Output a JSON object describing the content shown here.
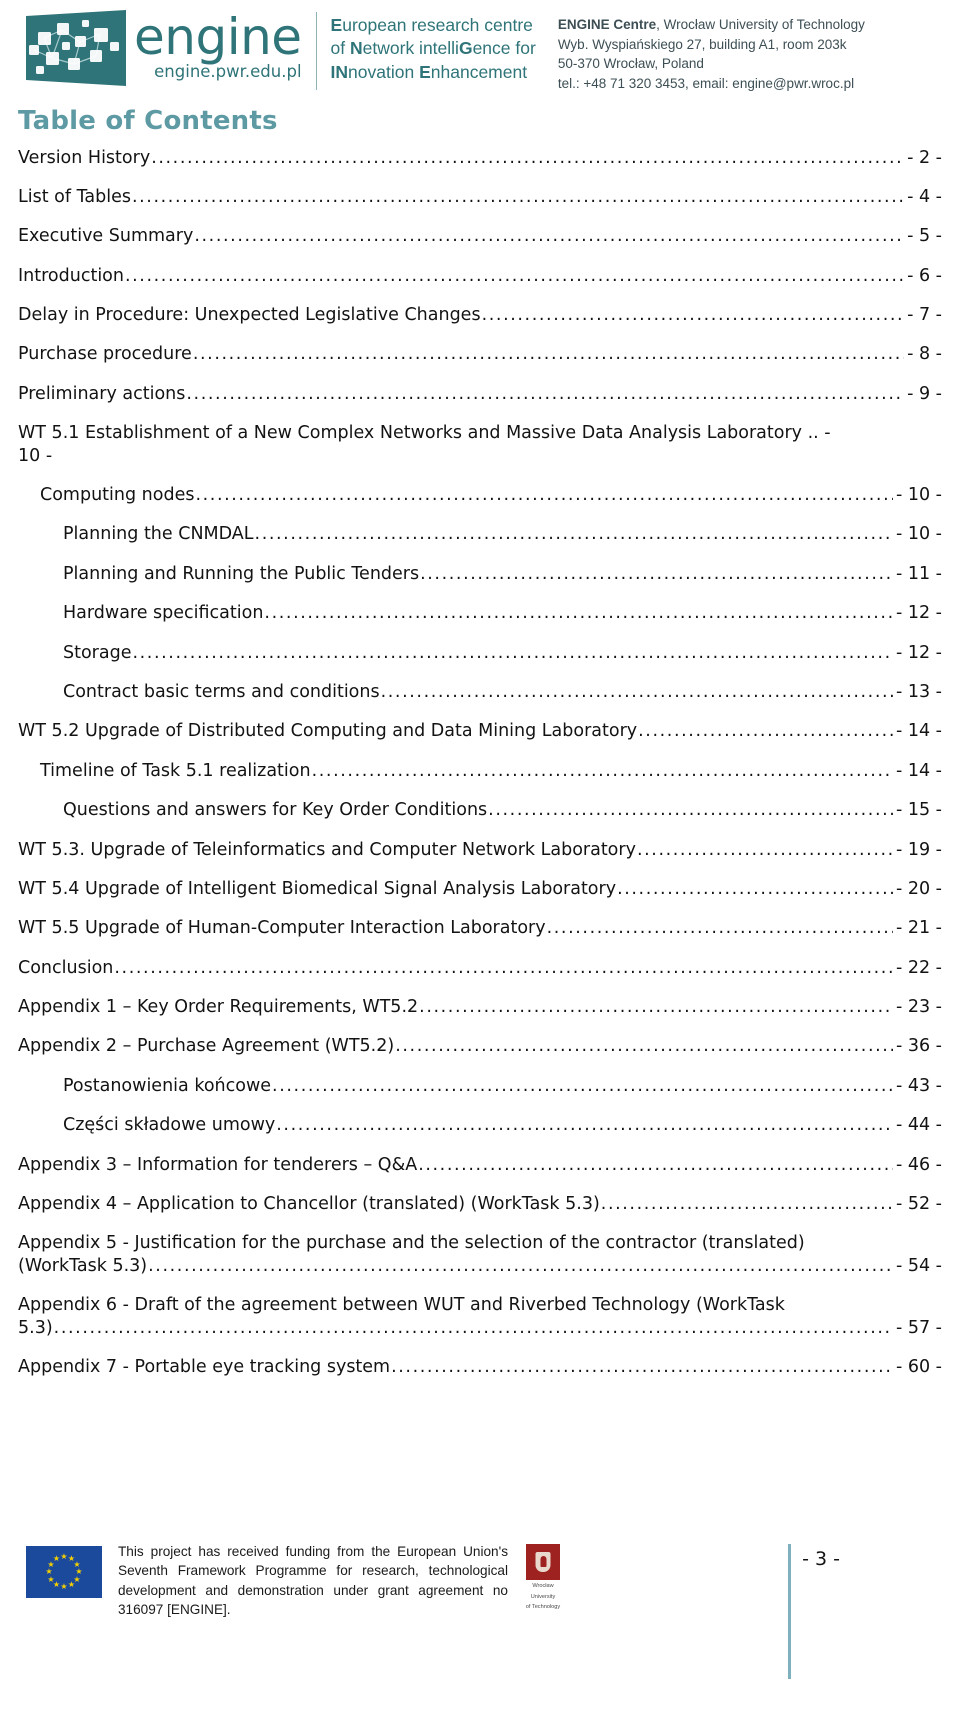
{
  "header": {
    "logo": {
      "wordmark": "engine",
      "url": "engine.pwr.edu.pl"
    },
    "tagline": {
      "line1_a": "E",
      "line1_b": "uropean research centre",
      "line2_a": "N",
      "line2_b": "etwork intelli",
      "line2_c": "G",
      "line2_d": "ence for",
      "line2_pre": "of ",
      "line3_a": "IN",
      "line3_b": "novation ",
      "line3_c": "E",
      "line3_d": "nhancement",
      "full_line1": "European research centre",
      "full_line2": "of Network intelliGence for",
      "full_line3": "INnovation Enhancement"
    },
    "contact": {
      "org_bold": "ENGINE Centre",
      "org_rest": ", Wrocław University of Technology",
      "address1": "Wyb. Wyspiańskiego 27, building A1, room 203k",
      "address2": "50-370 Wrocław, Poland",
      "contact_line": "tel.: +48 71 320 3453, email: engine@pwr.wroc.pl"
    }
  },
  "toc": {
    "title": "Table of Contents",
    "entries": [
      {
        "label": "Version History",
        "page": "- 2 -",
        "level": 0
      },
      {
        "label": "List of Tables",
        "page": "- 4 -",
        "level": 0
      },
      {
        "label": "Executive Summary",
        "page": "- 5 -",
        "level": 0
      },
      {
        "label": "Introduction",
        "page": "- 6 -",
        "level": 0
      },
      {
        "label": "Delay in Procedure: Unexpected  Legislative Changes",
        "page": "- 7 -",
        "level": 0
      },
      {
        "label": "Purchase procedure",
        "page": "- 8 -",
        "level": 0
      },
      {
        "label": "Preliminary actions",
        "page": "- 9 -",
        "level": 0
      },
      {
        "label": "WT 5.1 Establishment of a New Complex Networks and Massive Data Analysis Laboratory",
        "page": "- 10 -",
        "level": 0,
        "wrap": true,
        "wrap_tail": "10 -",
        "wrap_head_dots": ".. -"
      },
      {
        "label": "Computing nodes",
        "page": "- 10 -",
        "level": 1
      },
      {
        "label": "Planning the CNMDAL",
        "page": "- 10 -",
        "level": 2
      },
      {
        "label": "Planning and Running the Public Tenders",
        "page": "- 11 -",
        "level": 2
      },
      {
        "label": "Hardware specification",
        "page": "- 12 -",
        "level": 2
      },
      {
        "label": "Storage",
        "page": "- 12 -",
        "level": 2
      },
      {
        "label": "Contract basic terms and conditions",
        "page": "- 13 -",
        "level": 2
      },
      {
        "label": "WT 5.2 Upgrade of Distributed Computing and Data Mining Laboratory",
        "page": "- 14 -",
        "level": 0
      },
      {
        "label": "Timeline of Task 5.1 realization",
        "page": "- 14 -",
        "level": 1
      },
      {
        "label": "Questions and answers for Key Order Conditions",
        "page": "- 15 -",
        "level": 2
      },
      {
        "label": "WT 5.3. Upgrade of Teleinformatics and Computer Network Laboratory",
        "page": "- 19 -",
        "level": 0
      },
      {
        "label": "WT 5.4 Upgrade of Intelligent Biomedical Signal Analysis Laboratory",
        "page": "- 20 -",
        "level": 0
      },
      {
        "label": "WT 5.5 Upgrade of Human-Computer Interaction Laboratory",
        "page": "- 21 -",
        "level": 0
      },
      {
        "label": "Conclusion",
        "page": "- 22 -",
        "level": 0
      },
      {
        "label": "Appendix 1 – Key Order Requirements, WT5.2",
        "page": "- 23 -",
        "level": 0
      },
      {
        "label": "Appendix 2 – Purchase Agreement (WT5.2)",
        "page": "- 36 -",
        "level": 0
      },
      {
        "label": "Postanowienia końcowe",
        "page": "- 43 -",
        "level": 2
      },
      {
        "label": "Części składowe umowy",
        "page": "- 44 -",
        "level": 2
      },
      {
        "label": "Appendix 3 – Information for tenderers – Q&A",
        "page": "- 46 -",
        "level": 0
      },
      {
        "label": "Appendix 4 – Application to  Chancellor (translated) (WorkTask 5.3)",
        "page": "- 52 -",
        "level": 0
      },
      {
        "label": "Appendix 5 - Justification for the purchase and the selection of the contractor (translated)",
        "page": "- 54 -",
        "level": 0,
        "wrap": true,
        "wrap_tail": "(WorkTask 5.3)"
      },
      {
        "label": "Appendix 6 - Draft of the agreement between WUT and Riverbed Technology (WorkTask",
        "page": "- 57 -",
        "level": 0,
        "wrap": true,
        "wrap_tail": "5.3)"
      },
      {
        "label": "Appendix 7 - Portable eye tracking system",
        "page": "- 60 -",
        "level": 0
      }
    ]
  },
  "footer": {
    "funding_text": "This project has received funding from the European Union's Seventh Framework Programme for research, technological development and demonstration under grant agreement no 316097 [ENGINE].",
    "university_caption_1": "Wrocław",
    "university_caption_2": "University",
    "university_caption_3": "of Technology",
    "page_number": "- 3 -"
  },
  "colors": {
    "brand_teal": "#2e7478",
    "heading_teal": "#5d9aa3",
    "eu_blue": "#1b4a9c",
    "eu_star": "#f4d000",
    "pwr_red": "#9d2220",
    "rule_teal": "#7fb0bd"
  }
}
